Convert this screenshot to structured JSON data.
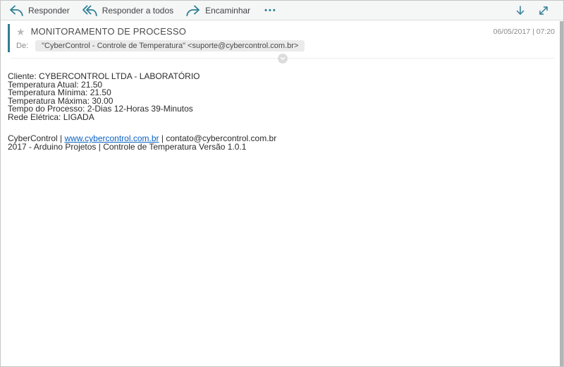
{
  "toolbar": {
    "reply_label": "Responder",
    "reply_all_label": "Responder a todos",
    "forward_label": "Encaminhar",
    "more_label": "•••"
  },
  "header": {
    "subject": "MONITORAMENTO DE PROCESSO",
    "date": "06/05/2017 | 07:20",
    "from_label": "De:",
    "from_value": "\"CyberControl - Controle de Temperatura\" <suporte@cybercontrol.com.br>"
  },
  "body": {
    "lines": [
      "Cliente: CYBERCONTROL LTDA - LABORATÓRIO",
      "Temperatura Atual: 21.50",
      "Temperatura Mínima: 21.50",
      "Temperatura Máxima: 30.00",
      "Tempo do Processo: 2-Dias 12-Horas 39-Minutos",
      "Rede Elétrica: LIGADA"
    ],
    "signature": {
      "line1_prefix": "CyberControl | ",
      "link": "www.cybercontrol.com.br",
      "line1_suffix": " | contato@cybercontrol.com.br",
      "line2": "2017 - Arduino Projetos | Controle de Temperatura Versão 1.0.1"
    }
  },
  "icons": {
    "reply": "reply-arrow",
    "reply_all": "reply-all-arrow",
    "forward": "forward-arrow",
    "more": "ellipsis",
    "move_down": "down-arrow",
    "expand": "diagonal-expand-arrow",
    "star": "★",
    "collapse": "chevron-down"
  },
  "colors": {
    "accent": "#2e7f95",
    "link": "#0b62c4",
    "toolbar_bg": "#f5f6f6",
    "chip_bg": "#ebebeb",
    "unread_bar": "#2e7f95",
    "star": "#b9b9b9",
    "scrollbar": "#b3b6b7"
  }
}
